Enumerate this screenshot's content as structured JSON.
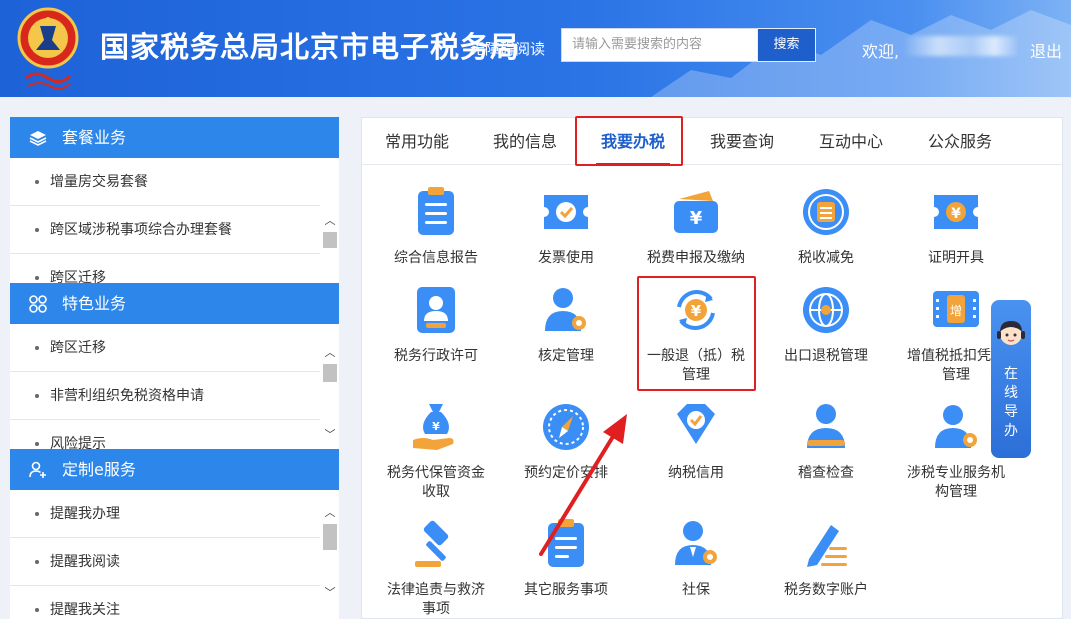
{
  "header": {
    "title": "国家税务总局北京市电子税务局",
    "read_link": "无障碍阅读",
    "search_placeholder": "请输入需要搜索的内容",
    "search_button": "搜索",
    "welcome": "欢迎,",
    "logout": "退出"
  },
  "sidebar": {
    "sections": [
      {
        "title": "套餐业务",
        "icon": "layers-icon",
        "items": [
          "增量房交易套餐",
          "跨区域涉税事项综合办理套餐",
          "跨区迁移"
        ]
      },
      {
        "title": "特色业务",
        "icon": "grid-icon",
        "items": [
          "跨区迁移",
          "非营利组织免税资格申请",
          "风险提示"
        ]
      },
      {
        "title": "定制e服务",
        "icon": "user-plus-icon",
        "items": [
          "提醒我办理",
          "提醒我阅读",
          "提醒我关注"
        ]
      }
    ]
  },
  "tabs": [
    {
      "label": "常用功能",
      "active": false
    },
    {
      "label": "我的信息",
      "active": false
    },
    {
      "label": "我要办税",
      "active": true
    },
    {
      "label": "我要查询",
      "active": false
    },
    {
      "label": "互动中心",
      "active": false
    },
    {
      "label": "公众服务",
      "active": false
    }
  ],
  "grid": [
    {
      "label": "综合信息报告",
      "icon": "clipboard-icon"
    },
    {
      "label": "发票使用",
      "icon": "ticket-check-icon"
    },
    {
      "label": "税费申报及缴纳",
      "icon": "wallet-icon"
    },
    {
      "label": "税收减免",
      "icon": "tax-seal-icon"
    },
    {
      "label": "证明开具",
      "icon": "certificate-icon"
    },
    {
      "label": "税务行政许可",
      "icon": "id-badge-icon"
    },
    {
      "label": "核定管理",
      "icon": "user-gear-icon"
    },
    {
      "label": "一般退（抵）税管理",
      "icon": "refund-cycle-icon"
    },
    {
      "label": "出口退税管理",
      "icon": "globe-icon"
    },
    {
      "label": "增值税抵扣凭证管理",
      "icon": "vat-ticket-icon"
    },
    {
      "label": "税务代保管资金收取",
      "icon": "money-bag-hand-icon"
    },
    {
      "label": "预约定价安排",
      "icon": "compass-icon"
    },
    {
      "label": "纳税信用",
      "icon": "diamond-check-icon"
    },
    {
      "label": "稽查检查",
      "icon": "inspector-icon"
    },
    {
      "label": "涉税专业服务机构管理",
      "icon": "user-gear-icon"
    },
    {
      "label": "法律追责与救济事项",
      "icon": "gavel-icon"
    },
    {
      "label": "其它服务事项",
      "icon": "document-list-icon"
    },
    {
      "label": "社保",
      "icon": "person-gear-icon"
    },
    {
      "label": "税务数字账户",
      "icon": "pen-lines-icon"
    }
  ],
  "guide": {
    "label": "在线导办",
    "chars": [
      "在",
      "线",
      "导",
      "办"
    ]
  },
  "colors": {
    "primary": "#1f5fcc",
    "sidebar_head": "#2d86ea",
    "highlight": "#e02020"
  }
}
